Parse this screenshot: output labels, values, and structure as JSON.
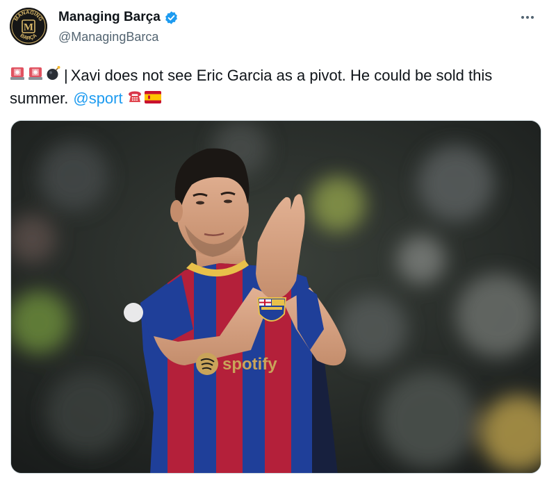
{
  "author": {
    "display_name": "Managing Barça",
    "handle": "@ManagingBarca",
    "verified": true,
    "avatar": {
      "ring_text_top": "MANAGING",
      "ring_text_bottom": "BARÇA",
      "monogram": "M",
      "colors": {
        "background": "#161616",
        "gold": "#d8b769"
      }
    }
  },
  "tweet": {
    "icons": [
      "rotating-light-icon",
      "rotating-light-icon",
      "bomb-icon"
    ],
    "separator": "|",
    "line1_text": "Xavi does not see Eric Garcia as a pivot. He could be sold this",
    "line2_text": "summer.",
    "mention": "@sport",
    "trailing_icons": [
      "telephone-icon",
      "spain-flag-icon"
    ]
  },
  "media": {
    "type": "photo",
    "shirt_text": "spotify",
    "colors": {
      "blue": "#1f3f99",
      "red": "#b4203a",
      "navy": "#17203e"
    }
  },
  "colors": {
    "accent": "#1d9bf0",
    "text": "#0f1419",
    "secondary_text": "#536471"
  }
}
